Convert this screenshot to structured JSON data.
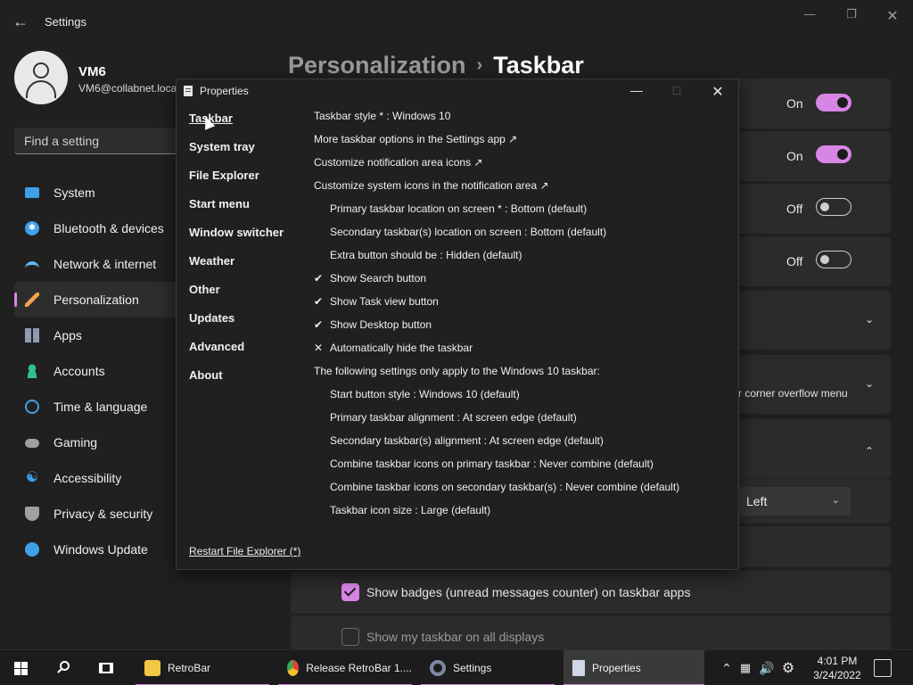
{
  "settings": {
    "app_title": "Settings",
    "profile": {
      "name": "VM6",
      "email": "VM6@collabnet.loca"
    },
    "search_placeholder": "Find a setting",
    "nav": [
      {
        "label": "System",
        "icon": "display-icon",
        "color": "#3ea0e8"
      },
      {
        "label": "Bluetooth & devices",
        "icon": "bluetooth-icon",
        "color": "#3ea0e8"
      },
      {
        "label": "Network & internet",
        "icon": "wifi-icon",
        "color": "#5cb8f0"
      },
      {
        "label": "Personalization",
        "icon": "brush-icon",
        "color": "#f0a050",
        "active": true
      },
      {
        "label": "Apps",
        "icon": "apps-icon",
        "color": "#8c9bb0"
      },
      {
        "label": "Accounts",
        "icon": "person-icon",
        "color": "#2ec28a"
      },
      {
        "label": "Time & language",
        "icon": "clock-globe-icon",
        "color": "#3ea0e8"
      },
      {
        "label": "Gaming",
        "icon": "gamepad-icon",
        "color": "#a0a0a0"
      },
      {
        "label": "Accessibility",
        "icon": "accessibility-icon",
        "color": "#3ea0e8"
      },
      {
        "label": "Privacy & security",
        "icon": "shield-icon",
        "color": "#a0a0a0"
      },
      {
        "label": "Windows Update",
        "icon": "update-icon",
        "color": "#3ea0e8"
      }
    ],
    "heading": {
      "parent": "Personalization",
      "separator": "›",
      "current": "Taskbar"
    },
    "toggles": [
      {
        "state": "On"
      },
      {
        "state": "On"
      },
      {
        "state": "Off"
      },
      {
        "state": "Off"
      }
    ],
    "overflow_text": "r corner overflow menu",
    "alignment_value": "Left",
    "checkboxes": [
      {
        "label": "Show badges (unread messages counter) on taskbar apps",
        "checked": true
      },
      {
        "label": "Show my taskbar on all displays",
        "checked": false
      }
    ],
    "accent_color": "#d886e6"
  },
  "properties": {
    "title": "Properties",
    "nav": [
      "Taskbar",
      "System tray",
      "File Explorer",
      "Start menu",
      "Window switcher",
      "Weather",
      "Other",
      "Updates",
      "Advanced",
      "About"
    ],
    "options": [
      {
        "text": "Taskbar style * : Windows 10",
        "indent": 0,
        "mark": ""
      },
      {
        "text": "More taskbar options in the Settings app ↗",
        "indent": 0,
        "mark": ""
      },
      {
        "text": "Customize notification area icons ↗",
        "indent": 0,
        "mark": ""
      },
      {
        "text": "Customize system icons in the notification area ↗",
        "indent": 0,
        "mark": ""
      },
      {
        "text": "Primary taskbar location on screen * : Bottom (default)",
        "indent": 1,
        "mark": ""
      },
      {
        "text": "Secondary taskbar(s) location on screen : Bottom (default)",
        "indent": 1,
        "mark": ""
      },
      {
        "text": "Extra button should be : Hidden (default)",
        "indent": 1,
        "mark": ""
      },
      {
        "text": "Show Search button",
        "indent": 1,
        "mark": "✔"
      },
      {
        "text": "Show Task view button",
        "indent": 1,
        "mark": "✔"
      },
      {
        "text": "Show Desktop button",
        "indent": 1,
        "mark": "✔"
      },
      {
        "text": "Automatically hide the taskbar",
        "indent": 1,
        "mark": "✕"
      },
      {
        "text": "The following settings only apply to the Windows 10 taskbar:",
        "indent": 0,
        "mark": ""
      },
      {
        "text": "Start button style : Windows 10 (default)",
        "indent": 1,
        "mark": ""
      },
      {
        "text": "Primary taskbar alignment : At screen edge (default)",
        "indent": 1,
        "mark": ""
      },
      {
        "text": "Secondary taskbar(s) alignment : At screen edge (default)",
        "indent": 1,
        "mark": ""
      },
      {
        "text": "Combine taskbar icons on primary taskbar : Never combine (default)",
        "indent": 1,
        "mark": ""
      },
      {
        "text": "Combine taskbar icons on secondary taskbar(s) : Never combine (default)",
        "indent": 1,
        "mark": ""
      },
      {
        "text": "Taskbar icon size : Large (default)",
        "indent": 1,
        "mark": ""
      }
    ],
    "restart_link": "Restart File Explorer (*)"
  },
  "taskbar": {
    "apps": [
      {
        "label": "RetroBar",
        "icon": "folder-icon",
        "color": "#f2c744"
      },
      {
        "label": "Release RetroBar 1....",
        "icon": "chrome-icon",
        "color": "#4a8af4"
      },
      {
        "label": "Settings",
        "icon": "gear-icon",
        "color": "#7a8aa0"
      },
      {
        "label": "Properties",
        "icon": "document-icon",
        "color": "#d0d8e8",
        "active": true
      }
    ],
    "clock": {
      "time": "4:01 PM",
      "date": "3/24/2022"
    }
  }
}
